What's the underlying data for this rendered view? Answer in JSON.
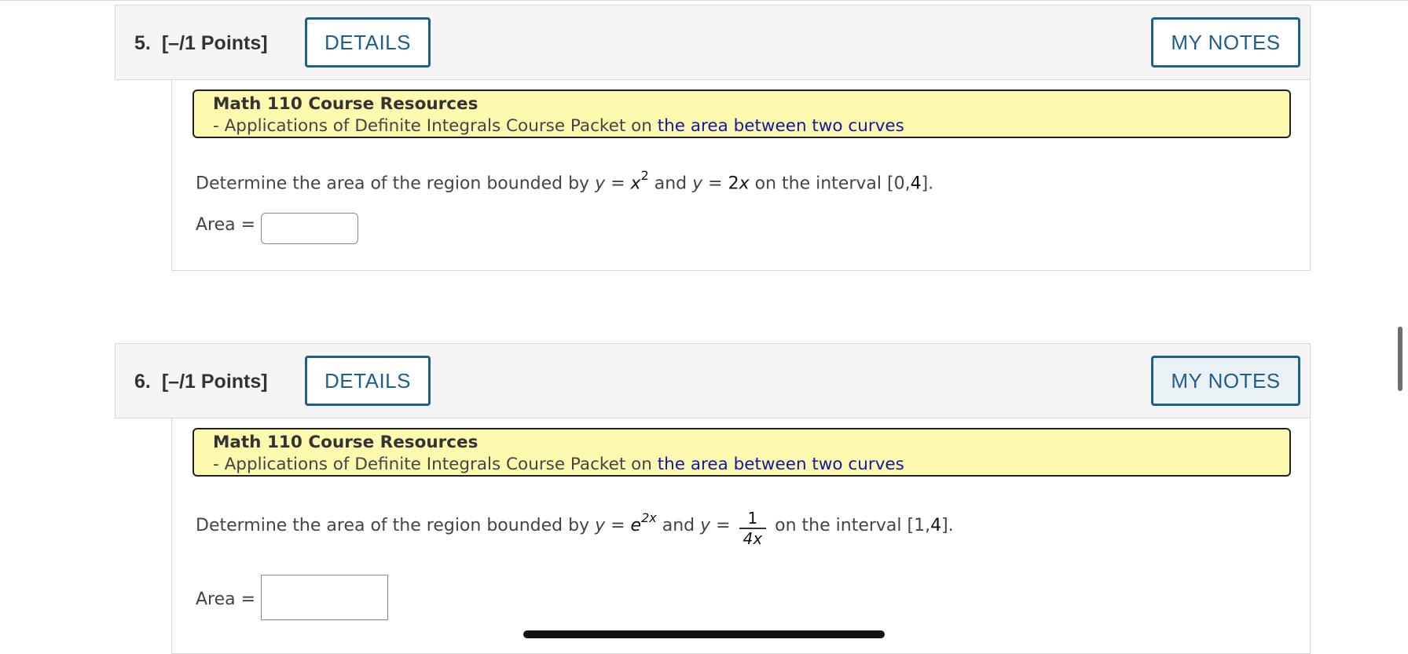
{
  "questions": [
    {
      "number": "5.",
      "points": "[–/1 Points]",
      "details_label": "DETAILS",
      "notes_label": "MY NOTES",
      "resource": {
        "title": "Math 110 Course Resources",
        "line_prefix": "- Applications of Definite Integrals Course Packet on",
        "link_text": "the area between two curves"
      },
      "prompt": {
        "lead": "Determine the area of the region bounded by",
        "y1": "y",
        "eq1": " = ",
        "f1_base": "x",
        "f1_exp": "2",
        "conj": " and ",
        "y2": "y",
        "eq2": " = ",
        "f2_coef": "2",
        "f2_var": "x",
        "interval_prefix": " on the interval [0,",
        "interval_end": "4",
        "interval_close": "]."
      },
      "answer_label": "Area =",
      "answer_value": ""
    },
    {
      "number": "6.",
      "points": "[–/1 Points]",
      "details_label": "DETAILS",
      "notes_label": "MY NOTES",
      "resource": {
        "title": "Math 110 Course Resources",
        "line_prefix": "- Applications of Definite Integrals Course Packet on",
        "link_text": "the area between two curves"
      },
      "prompt": {
        "lead": "Determine the area of the region bounded by",
        "y1": "y",
        "eq1": " = ",
        "f1_base": "e",
        "f1_exp": "2x",
        "conj": " and ",
        "y2": "y",
        "eq2": " = ",
        "frac_num": "1",
        "frac_den": "4x",
        "interval_prefix": " on the interval [1,",
        "interval_end": "4",
        "interval_close": "]."
      },
      "answer_label": "Area =",
      "answer_value": ""
    }
  ]
}
